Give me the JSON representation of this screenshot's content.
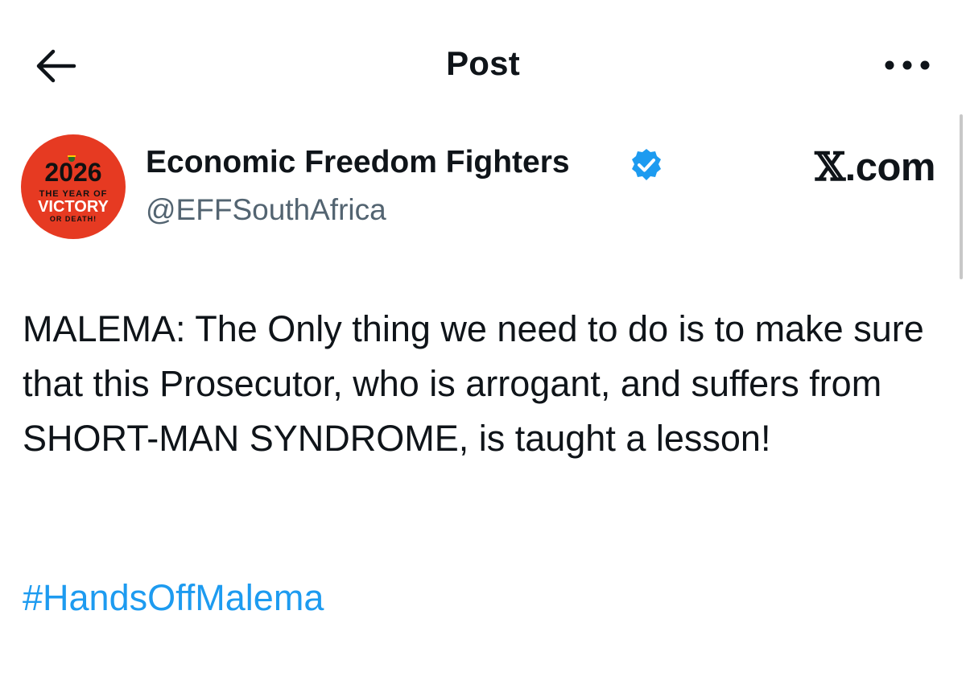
{
  "header": {
    "title": "Post",
    "back_icon": "arrow-left-icon",
    "more_icon": "more-horizontal-icon"
  },
  "author": {
    "name": "Economic Freedom Fighters",
    "handle": "@EFFSouthAfrica",
    "verified": true,
    "avatar": {
      "year": "2026",
      "line1": "THE YEAR OF",
      "line2": "VICTORY",
      "line3": "OR DEATH!",
      "background_color": "#e63a22"
    }
  },
  "brand": {
    "x_glyph": "𝕏",
    "domain": ".com"
  },
  "post": {
    "text": "MALEMA: The Only thing we need to do is to make sure that this Prosecutor, who is arrogant, and suffers from SHORT-MAN SYNDROME, is taught a lesson!",
    "hashtag": "#HandsOffMalema"
  },
  "colors": {
    "link": "#1d9bf0",
    "secondary_text": "#536471",
    "verified_badge": "#1d9bf0"
  }
}
